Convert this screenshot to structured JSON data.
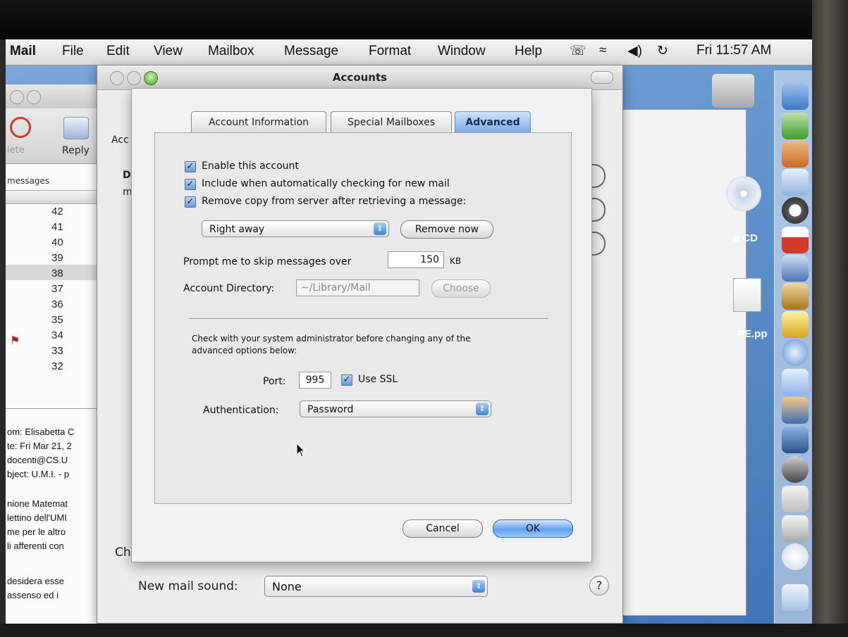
{
  "menubar": {
    "app": "Mail",
    "items": [
      "File",
      "Edit",
      "View",
      "Mailbox",
      "Message",
      "Format",
      "Window",
      "Help"
    ],
    "clock": "Fri 11:57 AM"
  },
  "mail_window": {
    "toolbar": {
      "delete_label": "lete",
      "reply_label": "Reply"
    },
    "list_header": "messages",
    "message_numbers": [
      "42",
      "41",
      "40",
      "39",
      "38",
      "37",
      "36",
      "35",
      "34",
      "33",
      "32"
    ],
    "preview_headers": [
      "om: Elisabetta C",
      "te: Fri Mar 21, 2",
      " docenti@CS.U",
      "bject: U.M.I. - p"
    ],
    "preview_body": [
      "nione Matemat",
      "lettino dell'UMI",
      "me per le altro",
      "li afferenti con",
      "",
      "desidera esse",
      "assenso ed i"
    ]
  },
  "pref_window": {
    "title": "Accounts",
    "toolbar_partial": "Acc",
    "list_header_partial": "D",
    "list_row_partial": "m",
    "check_partial": "Ch",
    "new_mail_sound_label": "New mail sound:",
    "new_mail_sound_value": "None",
    "help_label": "?"
  },
  "desktop": {
    "cd_label": "o CD",
    "file_label": "PE.pp"
  },
  "sheet": {
    "tabs": [
      "Account Information",
      "Special Mailboxes",
      "Advanced"
    ],
    "active_tab": "Advanced",
    "checkbox_enable": "Enable this account",
    "checkbox_include": "Include when automatically checking for new mail",
    "checkbox_remove": "Remove copy from server after retrieving a message:",
    "remove_when": "Right away",
    "remove_now_button": "Remove now",
    "prompt_label": "Prompt me to skip messages over",
    "prompt_value": "150",
    "prompt_unit": "KB",
    "account_dir_label": "Account Directory:",
    "account_dir_value": "~/Library/Mail",
    "choose_button": "Choose",
    "warning_line1": "Check with your system administrator before changing any of the",
    "warning_line2": "advanced options below:",
    "port_label": "Port:",
    "port_value": "995",
    "use_ssl_label": "Use SSL",
    "auth_label": "Authentication:",
    "auth_value": "Password",
    "cancel_button": "Cancel",
    "ok_button": "OK"
  },
  "colors": {
    "accent": "#5b9ae6",
    "desktop": "#5b8fcb"
  }
}
